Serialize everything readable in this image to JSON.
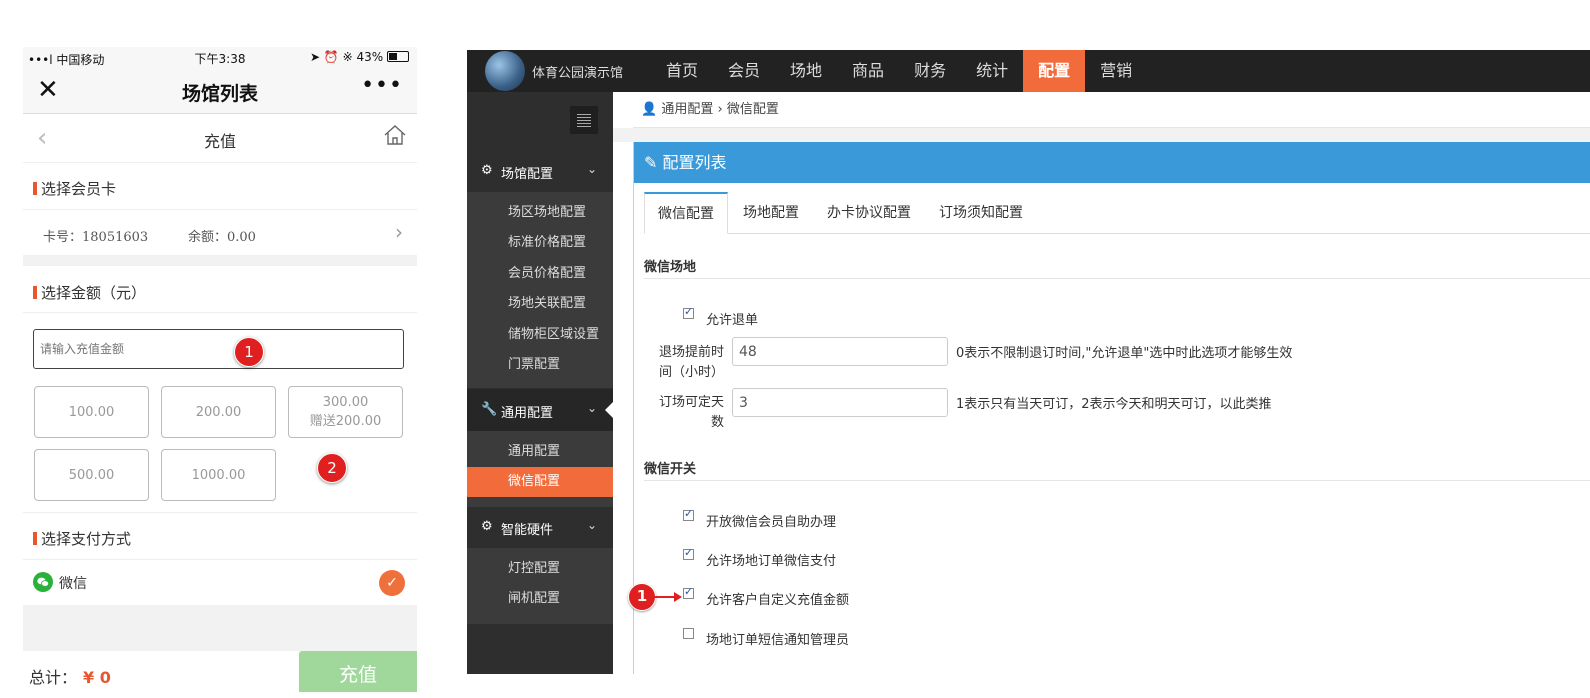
{
  "phone": {
    "status": {
      "signal": "•••l 中国移动",
      "time": "下午3:38",
      "battery": "43%"
    },
    "nav": {
      "title": "场馆列表"
    },
    "subnav": {
      "title": "充值"
    },
    "card_section": {
      "title": "选择会员卡",
      "card_no": "卡号：18051603",
      "balance": "余额：0.00"
    },
    "amount_section": {
      "title": "选择金额（元）",
      "placeholder": "请输入充值金额",
      "options": [
        {
          "amount": "100.00",
          "bonus": ""
        },
        {
          "amount": "200.00",
          "bonus": ""
        },
        {
          "amount": "300.00",
          "bonus": "赠送200.00"
        },
        {
          "amount": "500.00",
          "bonus": ""
        },
        {
          "amount": "1000.00",
          "bonus": ""
        }
      ]
    },
    "pay_section": {
      "title": "选择支付方式",
      "method": "微信"
    },
    "footer": {
      "total_label": "总计：",
      "total_value": "¥ 0",
      "pay_button": "充值"
    },
    "annotations": [
      "1",
      "2"
    ]
  },
  "admin": {
    "brand": "体育公园演示馆",
    "topnav": [
      "首页",
      "会员",
      "场地",
      "商品",
      "财务",
      "统计",
      "配置",
      "营销"
    ],
    "topnav_active": "配置",
    "sidebar": {
      "groups": [
        {
          "label": "场馆配置",
          "icon": "gears-icon",
          "items": [
            "场区场地配置",
            "标准价格配置",
            "会员价格配置",
            "场地关联配置",
            "储物柜区域设置",
            "门票配置"
          ]
        },
        {
          "label": "通用配置",
          "icon": "wrench-icon",
          "items": [
            "通用配置",
            "微信配置"
          ]
        },
        {
          "label": "智能硬件",
          "icon": "gear-icon",
          "items": [
            "灯控配置",
            "闸机配置"
          ]
        }
      ],
      "active_item": "微信配置"
    },
    "breadcrumb": {
      "parent": "通用配置",
      "separator": " › ",
      "current": "微信配置"
    },
    "panel": {
      "title": "配置列表",
      "tabs": [
        "微信配置",
        "场地配置",
        "办卡协议配置",
        "订场须知配置"
      ],
      "active_tab": "微信配置",
      "venue_group": {
        "title": "微信场地",
        "allow_refund": {
          "label": "允许退单",
          "checked": true
        },
        "refund_advance": {
          "label_line1": "退场提前时",
          "label_line2": "间（小时）",
          "value": "48",
          "hint": "0表示不限制退订时间,\"允许退单\"选中时此选项才能够生效"
        },
        "bookable_days": {
          "label_line1": "订场可定天",
          "label_line2": "数",
          "value": "3",
          "hint": "1表示只有当天可订，2表示今天和明天可订，以此类推"
        }
      },
      "switch_group": {
        "title": "微信开关",
        "options": [
          {
            "label": "开放微信会员自助办理",
            "checked": true
          },
          {
            "label": "允许场地订单微信支付",
            "checked": true
          },
          {
            "label": "允许客户自定义充值金额",
            "checked": true
          },
          {
            "label": "场地订单短信通知管理员",
            "checked": false
          }
        ]
      },
      "annotation": "1"
    }
  },
  "colors": {
    "accent_orange": "#f26b3a",
    "panel_blue": "#3a9ad9",
    "wechat_green": "#2ab13a",
    "annotation_red": "#e02020",
    "pay_button": "#9fd89a"
  }
}
